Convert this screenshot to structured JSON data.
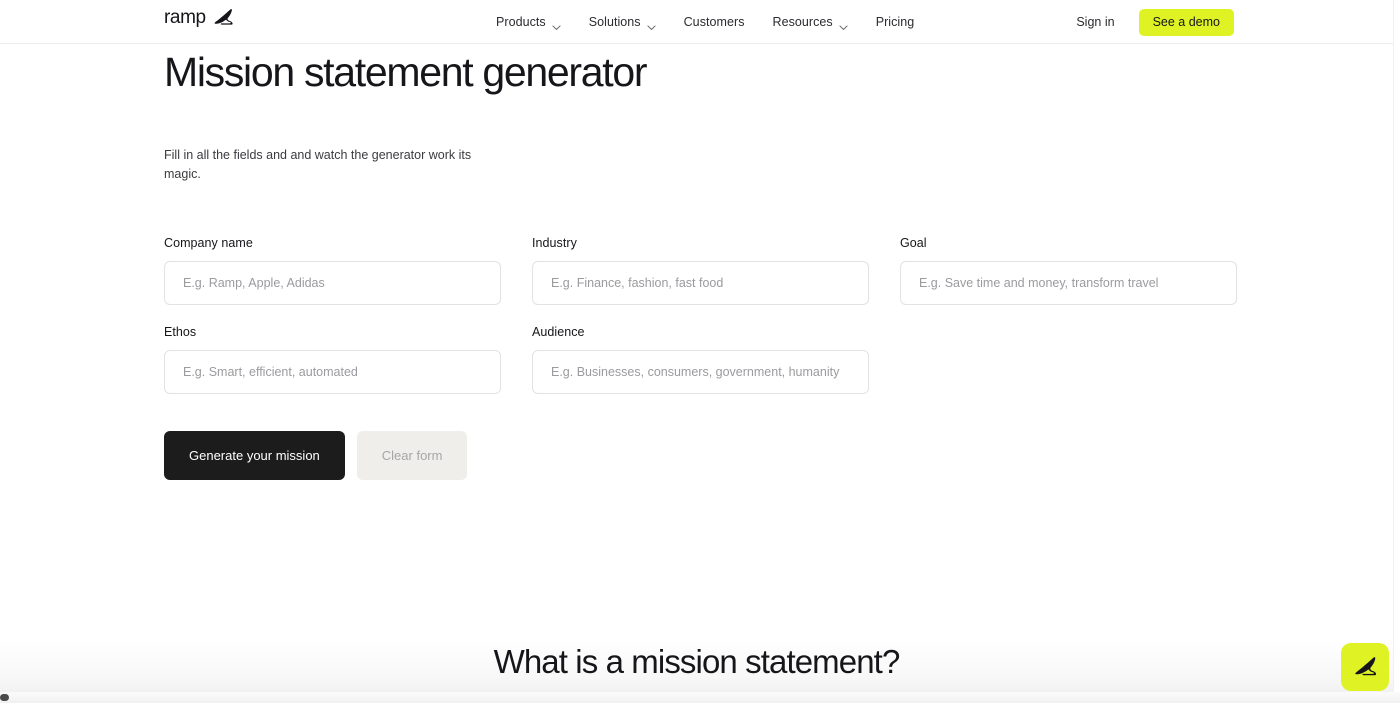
{
  "brand": {
    "name": "ramp",
    "logo_icon": "ramp-wedge-icon"
  },
  "header": {
    "nav_items": [
      {
        "label": "Products",
        "has_dropdown": true,
        "icon": "chevron-down-icon"
      },
      {
        "label": "Solutions",
        "has_dropdown": true,
        "icon": "chevron-down-icon"
      },
      {
        "label": "Customers",
        "has_dropdown": false,
        "icon": ""
      },
      {
        "label": "Resources",
        "has_dropdown": true,
        "icon": "chevron-down-icon"
      },
      {
        "label": "Pricing",
        "has_dropdown": false,
        "icon": ""
      }
    ],
    "sign_in_label": "Sign in",
    "demo_button_label": "See a demo"
  },
  "hero": {
    "title": "Mission statement generator",
    "subtitle": "Fill in all the fields and and watch the generator work its magic."
  },
  "form": {
    "fields": [
      {
        "label": "Company name",
        "placeholder": "E.g. Ramp, Apple, Adidas",
        "value": ""
      },
      {
        "label": "Industry",
        "placeholder": "E.g. Finance, fashion, fast food",
        "value": ""
      },
      {
        "label": "Goal",
        "placeholder": "E.g. Save time and money, transform travel",
        "value": ""
      },
      {
        "label": "Ethos",
        "placeholder": "E.g. Smart, efficient, automated",
        "value": ""
      },
      {
        "label": "Audience",
        "placeholder": "E.g. Businesses, consumers, government, humanity",
        "value": ""
      }
    ],
    "generate_button_label": "Generate your mission",
    "clear_button_label": "Clear form"
  },
  "next_section": {
    "heading": "What is a mission statement?"
  },
  "floating_widget": {
    "icon": "ramp-wedge-icon"
  },
  "colors": {
    "accent_yellow": "#dff224",
    "text_primary": "#16161a",
    "text_muted": "#9b9b9f",
    "button_dark": "#1c1c1c",
    "button_light": "#efeeea",
    "input_border": "#e2e2e2"
  }
}
